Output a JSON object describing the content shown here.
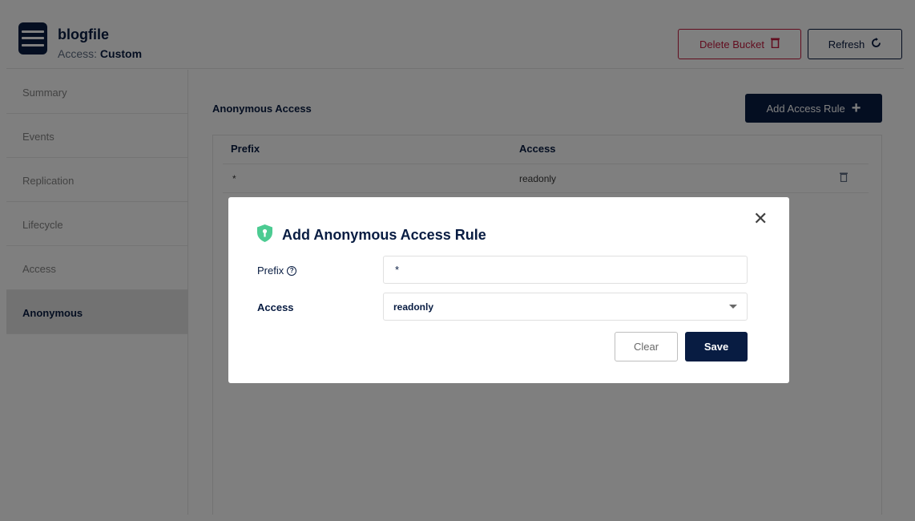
{
  "bucket": {
    "name": "blogfile",
    "access_label": "Access:",
    "access_value": "Custom"
  },
  "header_actions": {
    "delete_label": "Delete Bucket",
    "refresh_label": "Refresh"
  },
  "sidebar": {
    "items": [
      {
        "label": "Summary",
        "active": false
      },
      {
        "label": "Events",
        "active": false
      },
      {
        "label": "Replication",
        "active": false
      },
      {
        "label": "Lifecycle",
        "active": false
      },
      {
        "label": "Access",
        "active": false
      },
      {
        "label": "Anonymous",
        "active": true
      }
    ]
  },
  "main": {
    "section_title": "Anonymous Access",
    "add_rule_label": "Add Access Rule",
    "table": {
      "columns": [
        "Prefix",
        "Access"
      ],
      "rows": [
        {
          "prefix": "*",
          "access": "readonly"
        }
      ]
    }
  },
  "modal": {
    "title": "Add Anonymous Access Rule",
    "prefix_label": "Prefix",
    "prefix_value": "*",
    "access_label": "Access",
    "access_value": "readonly",
    "clear_label": "Clear",
    "save_label": "Save"
  },
  "colors": {
    "primary": "#081c42",
    "danger": "#c51b3f",
    "shield": "#4ccb92",
    "overlay": "rgba(0,0,0,0.5)"
  }
}
